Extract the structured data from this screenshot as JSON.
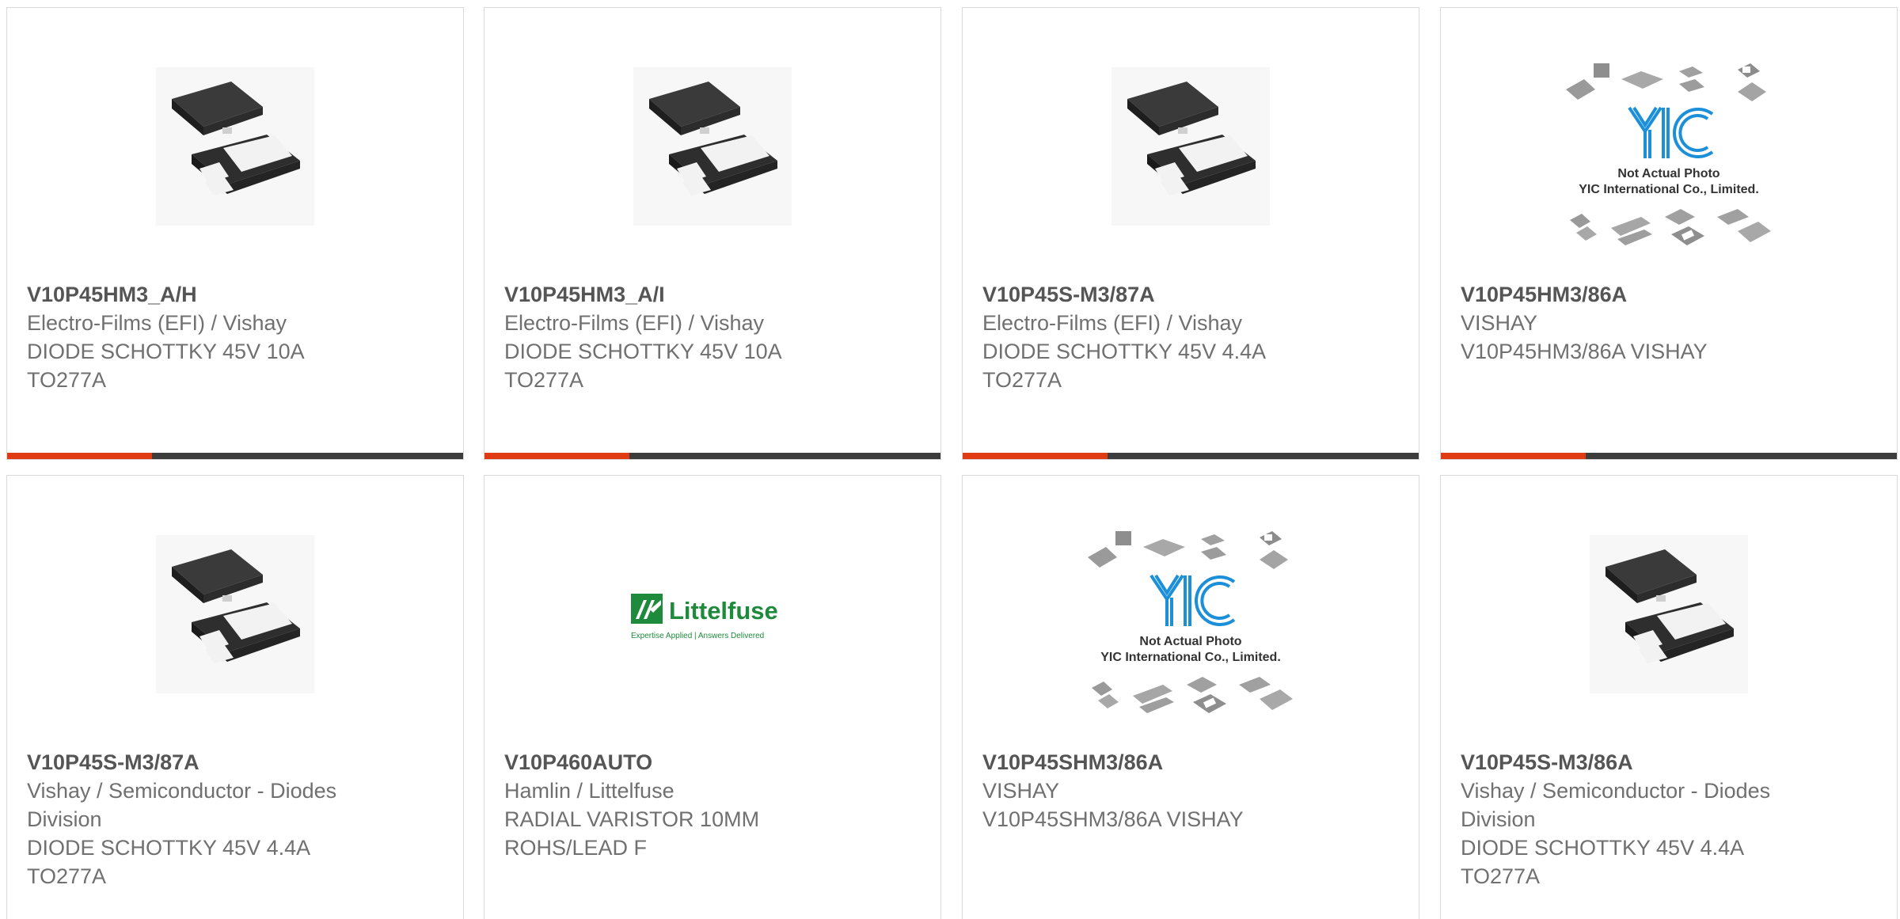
{
  "colors": {
    "accent": "#e03a12",
    "bar_dark": "#3c3c3c",
    "title_text": "#555555",
    "body_text": "#707070",
    "card_border": "#d9d9d9"
  },
  "products": [
    {
      "part_number": "V10P45HM3_A/H",
      "lines": [
        "Electro-Films (EFI) / Vishay",
        "DIODE SCHOTTKY 45V 10A",
        "TO277A"
      ],
      "image": "smd-diode-package-photo",
      "highlighted": true
    },
    {
      "part_number": "V10P45HM3_A/I",
      "lines": [
        "Electro-Films (EFI) / Vishay",
        "DIODE SCHOTTKY 45V 10A",
        "TO277A"
      ],
      "image": "smd-diode-package-photo",
      "highlighted": true
    },
    {
      "part_number": "V10P45S-M3/87A",
      "lines": [
        "Electro-Films (EFI) / Vishay",
        "DIODE SCHOTTKY 45V 4.4A",
        "TO277A"
      ],
      "image": "smd-diode-package-photo",
      "highlighted": true
    },
    {
      "part_number": "V10P45HM3/86A",
      "lines": [
        "VISHAY",
        "V10P45HM3/86A VISHAY"
      ],
      "image": "yic-not-actual-photo",
      "image_text": [
        "Not Actual Photo",
        "YIC International Co., Limited."
      ],
      "highlighted": true
    },
    {
      "part_number": "V10P45S-M3/87A",
      "lines": [
        "Vishay / Semiconductor - Diodes",
        "Division",
        "DIODE SCHOTTKY 45V 4.4A",
        "TO277A"
      ],
      "image": "smd-diode-package-photo",
      "highlighted": false
    },
    {
      "part_number": "V10P460AUTO",
      "lines": [
        "Hamlin / Littelfuse",
        "RADIAL VARISTOR 10MM",
        "ROHS/LEAD F"
      ],
      "image": "littelfuse-logo",
      "image_text": [
        "Littelfuse",
        "Expertise Applied | Answers Delivered"
      ],
      "highlighted": false
    },
    {
      "part_number": "V10P45SHM3/86A",
      "lines": [
        "VISHAY",
        "V10P45SHM3/86A VISHAY"
      ],
      "image": "yic-not-actual-photo",
      "image_text": [
        "Not Actual Photo",
        "YIC International Co., Limited."
      ],
      "highlighted": false
    },
    {
      "part_number": "V10P45S-M3/86A",
      "lines": [
        "Vishay / Semiconductor - Diodes",
        "Division",
        "DIODE SCHOTTKY 45V 4.4A",
        "TO277A"
      ],
      "image": "smd-diode-package-photo",
      "highlighted": false
    }
  ]
}
